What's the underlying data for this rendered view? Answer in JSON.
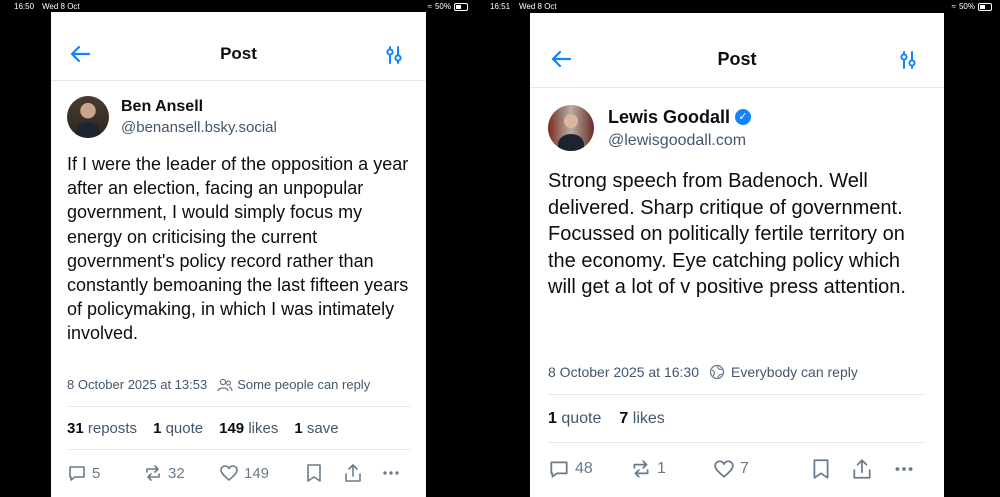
{
  "left": {
    "status": {
      "time": "16:50",
      "date": "Wed 8 Oct",
      "battery": "50%"
    },
    "header": {
      "title": "Post"
    },
    "author": {
      "name": "Ben Ansell",
      "handle": "@benansell.bsky.social"
    },
    "post_text": "If I were the leader of the opposition a year after an election, facing an unpopular government, I would simply focus my energy on criticising the current government's policy record rather than constantly bemoaning the last fifteen years of policymaking, in which I was intimately involved.",
    "timestamp": "8 October 2025 at 13:53",
    "reply_setting": "Some people can reply",
    "stats": {
      "reposts_count": "31",
      "reposts_label": "reposts",
      "quotes_count": "1",
      "quotes_label": "quote",
      "likes_count": "149",
      "likes_label": "likes",
      "saves_count": "1",
      "saves_label": "save"
    },
    "actions": {
      "reply_count": "5",
      "repost_count": "32",
      "like_count": "149"
    }
  },
  "right": {
    "status": {
      "time": "16:51",
      "date": "Wed 8 Oct",
      "battery": "50%"
    },
    "header": {
      "title": "Post"
    },
    "author": {
      "name": "Lewis Goodall",
      "handle": "@lewisgoodall.com"
    },
    "post_text": "Strong speech from Badenoch. Well delivered. Sharp critique of government. Focussed on politically fertile territory on the economy. Eye catching policy which will get a lot of v positive press attention.",
    "timestamp": "8 October 2025 at 16:30",
    "reply_setting": "Everybody can reply",
    "stats": {
      "quotes_count": "1",
      "quotes_label": "quote",
      "likes_count": "7",
      "likes_label": "likes"
    },
    "actions": {
      "reply_count": "48",
      "repost_count": "1",
      "like_count": "7"
    }
  }
}
